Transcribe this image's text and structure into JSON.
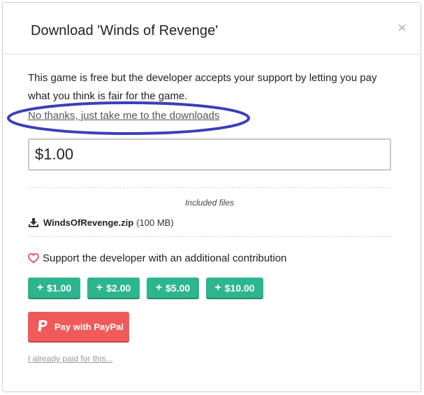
{
  "modal": {
    "title": "Download 'Winds of Revenge'",
    "close_symbol": "×",
    "intro_text": "This game is free but the developer accepts your support by letting you pay what you think is fair for the game.",
    "no_thanks_link": "No thanks, just take me to the downloads",
    "price_value": "$1.00",
    "included_files_label": "Included files",
    "files": [
      {
        "name": "WindsOfRevenge.zip",
        "size": "(100 MB)",
        "icon": "download-icon"
      }
    ],
    "support_text": "Support the developer with an additional contribution",
    "support_icon": "heart-icon",
    "contribution_buttons": [
      {
        "label": "$1.00"
      },
      {
        "label": "$2.00"
      },
      {
        "label": "$5.00"
      },
      {
        "label": "$10.00"
      }
    ],
    "plus_symbol": "+",
    "paypal_label": "Pay with PayPal",
    "already_paid_link": "I already paid for this...",
    "colors": {
      "accent_green": "#2cb58f",
      "paypal_red": "#f05a5a",
      "annotation_blue": "#3a3fb8"
    }
  }
}
